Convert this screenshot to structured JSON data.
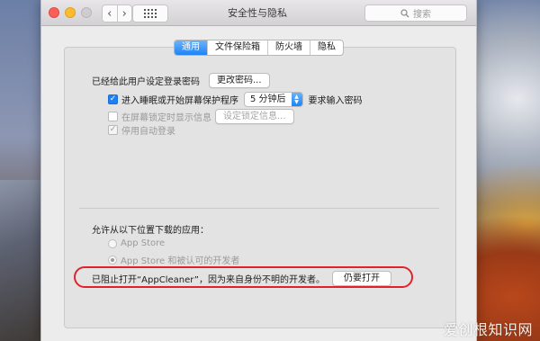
{
  "window": {
    "title": "安全性与隐私",
    "search_placeholder": "搜索"
  },
  "toolbar": {
    "back_symbol": "‹",
    "forward_symbol": "›"
  },
  "tabs": [
    {
      "label": "通用",
      "active": true
    },
    {
      "label": "文件保险箱",
      "active": false
    },
    {
      "label": "防火墙",
      "active": false
    },
    {
      "label": "隐私",
      "active": false
    }
  ],
  "general": {
    "password_set_text": "已经给此用户设定登录密码",
    "change_password_button": "更改密码...",
    "require_password": {
      "checked": true,
      "label_prefix": "进入睡眠或开始屏幕保护程序",
      "delay_value": "5 分钟后",
      "label_suffix": "要求输入密码"
    },
    "lock_message": {
      "checked": false,
      "enabled": false,
      "label": "在屏幕锁定时显示信息",
      "button": "设定锁定信息..."
    },
    "disable_autologin": {
      "checked": true,
      "enabled": false,
      "label": "停用自动登录"
    }
  },
  "downloads": {
    "heading": "允许从以下位置下载的应用：",
    "options": [
      {
        "label": "App Store",
        "selected": false
      },
      {
        "label": "App Store 和被认可的开发者",
        "selected": true
      }
    ],
    "blocked_message": "已阻止打开“AppCleaner”，因为来自身份不明的开发者。",
    "open_anyway_button": "仍要打开"
  },
  "watermark": "爱创根知识网",
  "colors": {
    "accent": "#1e83f6",
    "highlight_ring": "#e2222a"
  }
}
